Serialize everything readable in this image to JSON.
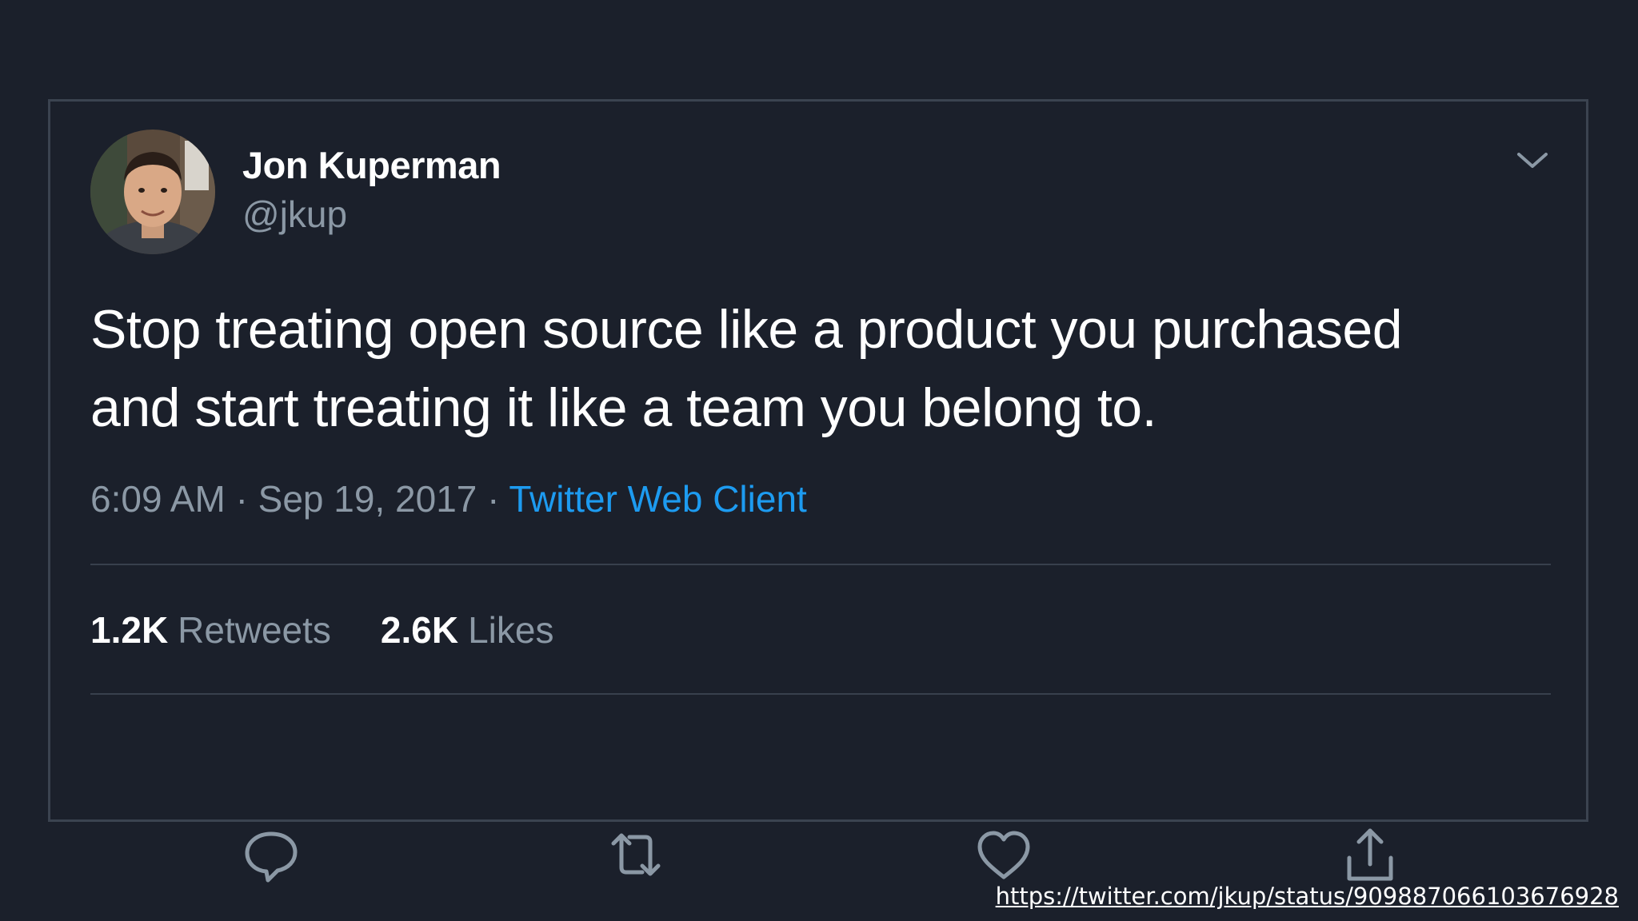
{
  "tweet": {
    "display_name": "Jon Kuperman",
    "handle": "@jkup",
    "text_line_1": "Stop treating open source like a product you purchased",
    "text_line_2": "and start treating it like a team you belong to.",
    "time": "6:09 AM",
    "date": "Sep 19, 2017",
    "separator": "·",
    "source": "Twitter Web Client",
    "retweets_count": "1.2K",
    "retweets_label": "Retweets",
    "likes_count": "2.6K",
    "likes_label": "Likes"
  },
  "icons": {
    "more": "chevron-down-icon",
    "reply": "comment-bubble-icon",
    "retweet": "retweet-arrows-icon",
    "like": "heart-icon",
    "share": "share-upload-icon"
  },
  "colors": {
    "background": "#1b202b",
    "border": "#3b4350",
    "text_primary": "#ffffff",
    "text_secondary": "#8b98a5",
    "link": "#1d9bf0"
  },
  "footer": {
    "url": "https://twitter.com/jkup/status/909887066103676928"
  }
}
